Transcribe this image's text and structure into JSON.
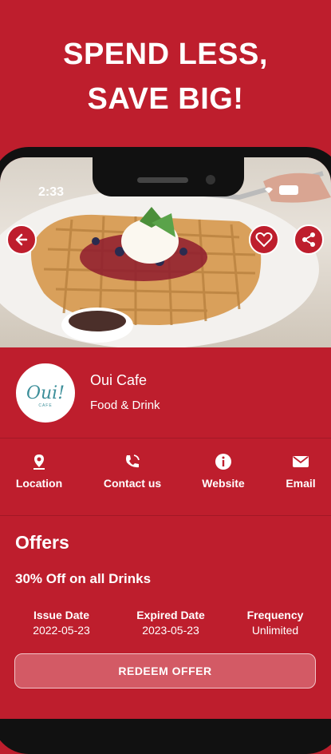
{
  "promo": {
    "line1": "SPEND LESS,",
    "line2": "SAVE BIG!"
  },
  "status_bar": {
    "time": "2:33"
  },
  "business": {
    "name": "Oui Cafe",
    "category": "Food & Drink",
    "logo_text": "Oui!",
    "logo_sub": "CAFE"
  },
  "actions": [
    {
      "label": "Location",
      "icon": "location-pin-icon"
    },
    {
      "label": "Contact us",
      "icon": "phone-icon"
    },
    {
      "label": "Website",
      "icon": "info-icon"
    },
    {
      "label": "Email",
      "icon": "email-icon"
    }
  ],
  "offers": {
    "title": "Offers",
    "offer_name": "30% Off on all Drinks",
    "issue_label": "Issue Date",
    "issue_value": "2022-05-23",
    "expired_label": "Expired Date",
    "expired_value": "2023-05-23",
    "frequency_label": "Frequency",
    "frequency_value": "Unlimited",
    "redeem_label": "REDEEM OFFER"
  },
  "colors": {
    "brand": "#be1e2d",
    "accent_text": "#ffffff"
  }
}
